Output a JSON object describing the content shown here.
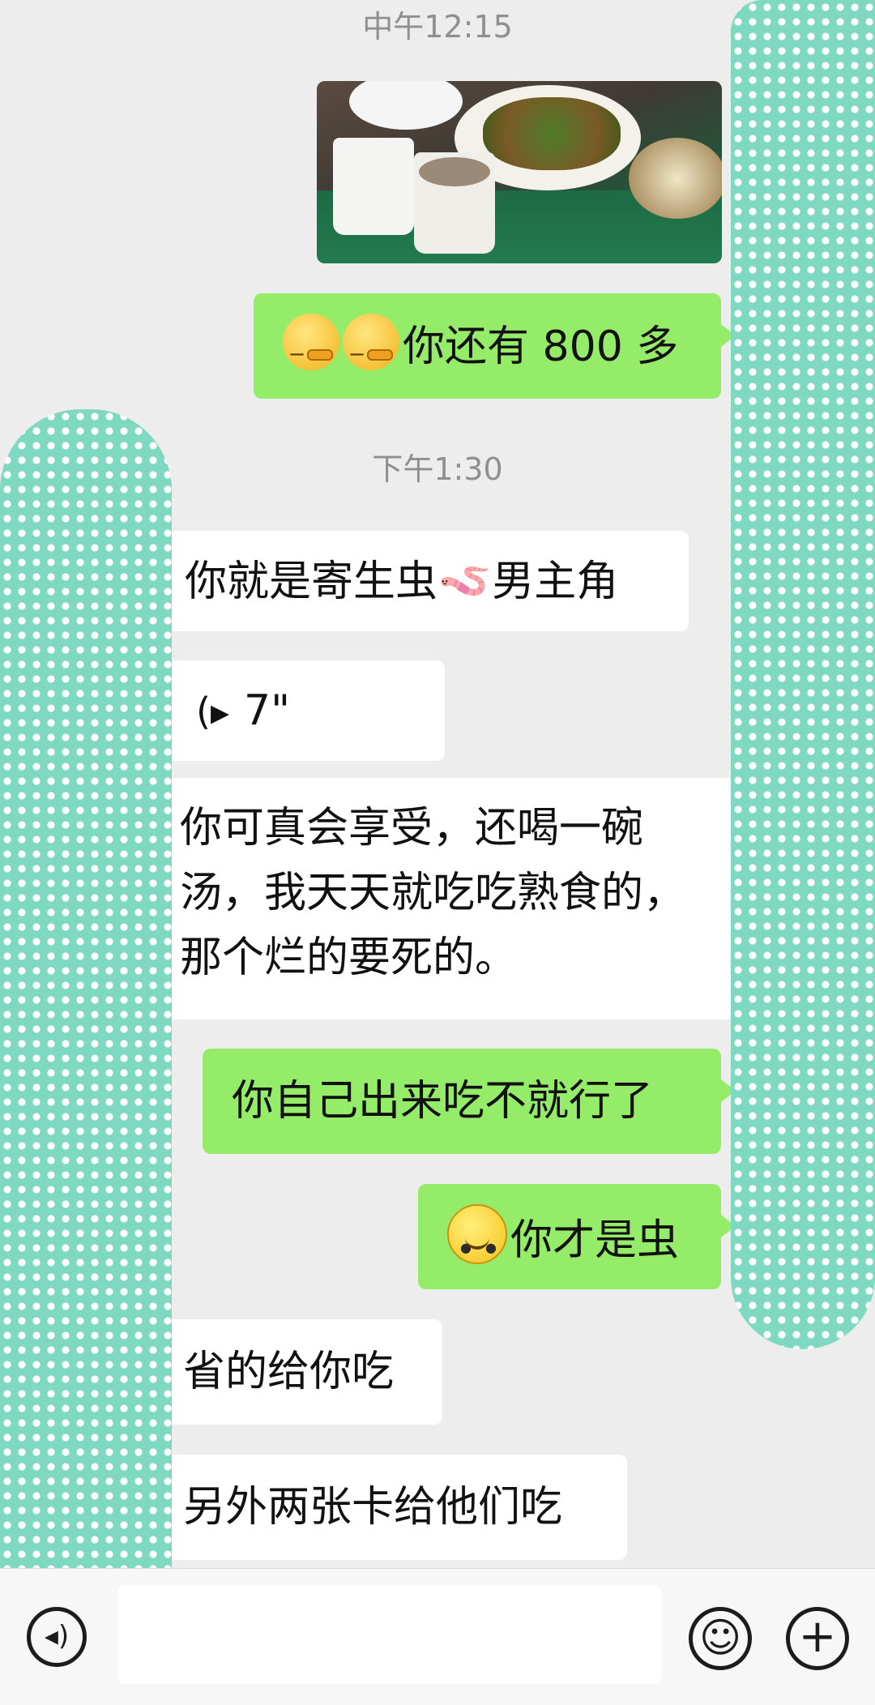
{
  "messages": {
    "time1": "中午12:15",
    "m_out1": "你还有 800 多",
    "time2": "下午1:30",
    "m_in1_a": "你就是寄生虫",
    "m_in1_emoji": "🪱",
    "m_in1_b": "男主角",
    "voice_duration": "7\"",
    "m_in3": "你可真会享受，还喝一碗汤，我天天就吃吃熟食的，那个烂的要死的。",
    "m_out2": "你自己出来吃不就行了",
    "m_out3": "你才是虫",
    "m_in4": "省的给你吃",
    "m_in5": "另外两张卡给他们吃"
  },
  "icons": {
    "voice": "voice-icon",
    "emoji": "emoji-icon",
    "add": "add-icon"
  },
  "colors": {
    "outgoing_bubble": "#95ec69",
    "incoming_bubble": "#ffffff",
    "background": "#ededed",
    "redaction": "#7fd8c0"
  }
}
